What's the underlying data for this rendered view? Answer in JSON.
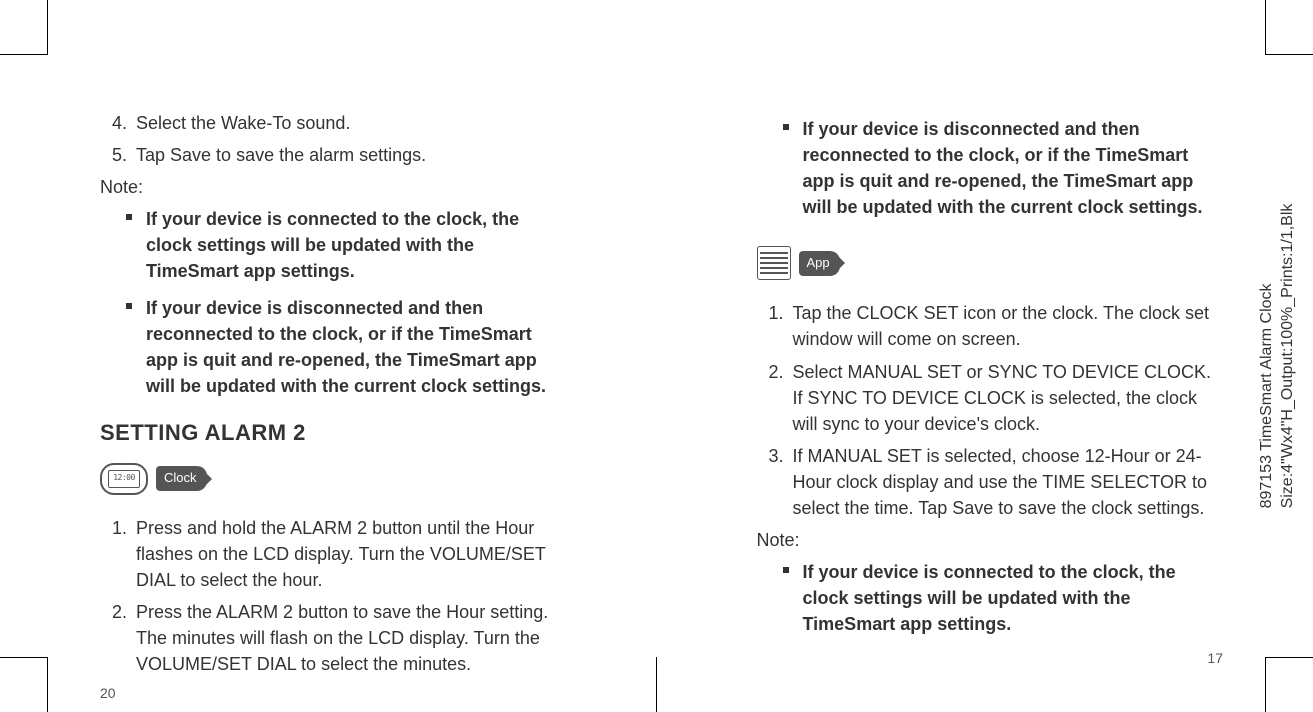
{
  "left_page": {
    "number": "20",
    "steps_continued": [
      {
        "num": "4.",
        "text": "Select the Wake-To sound."
      },
      {
        "num": "5.",
        "text": "Tap Save to save the alarm settings."
      }
    ],
    "note_label": "Note:",
    "notes": [
      "If your device is connected to the clock, the clock settings will be updated with the TimeSmart app settings.",
      "If your device is disconnected and then reconnected to the clock, or if the TimeSmart app is quit and re-opened, the TimeSmart app will be updated with the current clock settings."
    ],
    "heading": "SETTING ALARM 2",
    "badge_label": "Clock",
    "clock_digits": "12:00",
    "alarm2_steps": [
      "Press and hold the ALARM 2 button until the Hour flashes on the LCD display. Turn the VOLUME/SET DIAL to select the hour.",
      "Press the ALARM 2 button to save the Hour setting. The minutes will flash on the LCD display. Turn the VOLUME/SET DIAL to select the minutes."
    ]
  },
  "right_page": {
    "number": "17",
    "top_notes": [
      "If your device is disconnected and then reconnected to the clock, or if the TimeSmart app is quit and re-opened, the TimeSmart app will be updated with the current clock settings."
    ],
    "badge_label": "App",
    "app_steps": [
      "Tap the CLOCK SET icon or the clock. The clock set window will come on screen.",
      "Select MANUAL SET or SYNC TO DEVICE CLOCK. If SYNC TO DEVICE CLOCK is selected, the clock will sync to your device's clock.",
      "If MANUAL SET is selected, choose 12-Hour or 24-Hour clock display and use the TIME SELECTOR to select the time. Tap Save to save the clock settings."
    ],
    "note_label": "Note:",
    "notes": [
      "If your device is connected to the clock, the clock settings will be updated with the TimeSmart app settings."
    ]
  },
  "side_label_line1": "897153 TimeSmart Alarm Clock",
  "side_label_line2": "Size:4\"Wx4\"H_Output:100%_Prints:1/1,Blk"
}
